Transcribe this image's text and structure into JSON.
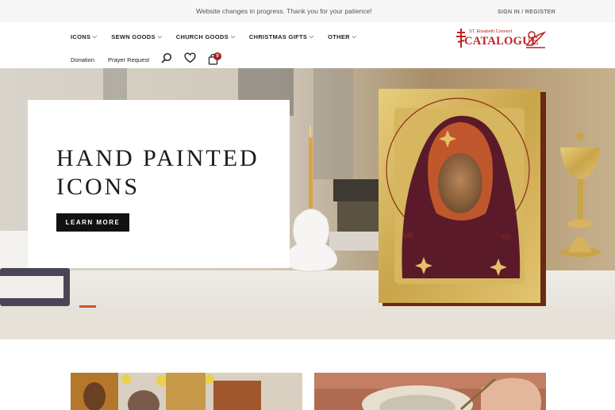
{
  "announcement": "Website changes in progress. Thank you for your patience!",
  "auth_link": "SIGN IN / REGISTER",
  "nav": {
    "primary": [
      {
        "label": "ICONS"
      },
      {
        "label": "SEWN GOODS"
      },
      {
        "label": "CHURCH GOODS"
      },
      {
        "label": "CHRISTMAS GIFTS"
      },
      {
        "label": "OTHER"
      }
    ],
    "secondary": {
      "donation": "Donation",
      "prayer_request": "Prayer Request"
    },
    "cart_count": "0"
  },
  "logo": {
    "tagline": "ST. Elisabeth Convent",
    "wordmark": "CATALOGUE"
  },
  "hero": {
    "title_line1": "HAND PAINTED",
    "title_line2": "ICONS",
    "button_label": "LEARN MORE"
  },
  "colors": {
    "brand_red": "#b22222",
    "button_black": "#111111",
    "icon_gold": "#c9a54a",
    "robe_maroon": "#5a1a2a"
  },
  "icons": [
    "search-icon",
    "heart-icon",
    "bag-icon",
    "chevron-down-icon"
  ]
}
